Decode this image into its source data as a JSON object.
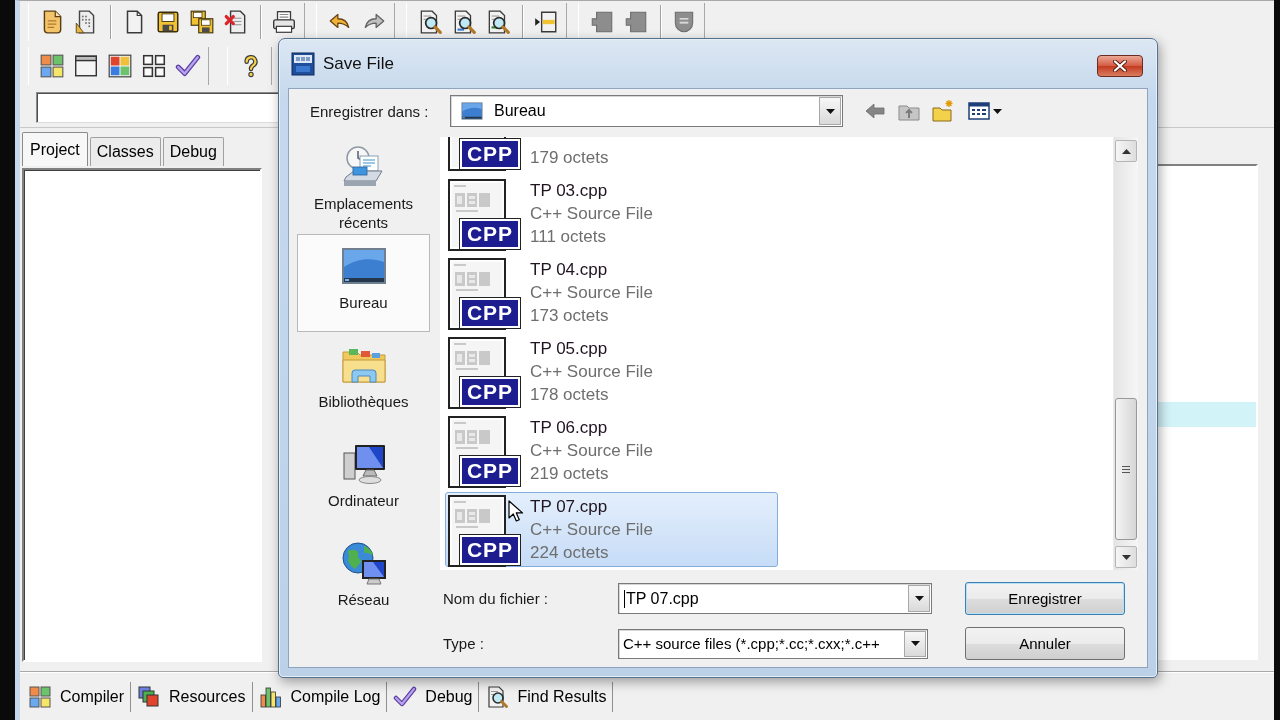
{
  "toolbar_rows": [
    [
      {
        "groups": [
          [
            {
              "kind": "project",
              "disabled": false
            },
            {
              "kind": "template",
              "disabled": false
            }
          ],
          [
            {
              "kind": "file",
              "disabled": false
            },
            {
              "kind": "save",
              "disabled": false
            },
            {
              "kind": "saveall",
              "disabled": false
            },
            {
              "kind": "close",
              "disabled": false
            }
          ],
          [
            {
              "kind": "print",
              "disabled": false
            }
          ]
        ]
      },
      {
        "groups": [
          [
            {
              "kind": "undo",
              "disabled": false
            },
            {
              "kind": "redo",
              "disabled": true
            }
          ]
        ]
      },
      {
        "groups": [
          [
            {
              "kind": "find",
              "disabled": false
            },
            {
              "kind": "replace",
              "disabled": false
            },
            {
              "kind": "findnext",
              "disabled": false
            }
          ],
          [
            {
              "kind": "goto",
              "disabled": false
            }
          ]
        ]
      },
      {
        "groups": [
          [
            {
              "kind": "notch",
              "disabled": true
            },
            {
              "kind": "notch",
              "disabled": true
            }
          ],
          [
            {
              "kind": "shield",
              "disabled": true
            }
          ]
        ]
      }
    ],
    [
      {
        "groups": [
          [
            {
              "kind": "compile",
              "disabled": false
            },
            {
              "kind": "run",
              "disabled": false
            },
            {
              "kind": "compilerun",
              "disabled": false
            },
            {
              "kind": "rebuild",
              "disabled": false
            },
            {
              "kind": "debug",
              "disabled": false
            }
          ]
        ]
      },
      {
        "groups": [
          [
            {
              "kind": "help",
              "disabled": false
            }
          ]
        ]
      }
    ]
  ],
  "left_tabs": [
    {
      "label": "Project",
      "selected": true
    },
    {
      "label": "Classes",
      "selected": false
    },
    {
      "label": "Debug",
      "selected": false
    }
  ],
  "bottom_tabs": [
    {
      "label": "Compiler",
      "kind": "compiler",
      "selected": false
    },
    {
      "label": "Resources",
      "kind": "resources",
      "selected": false
    },
    {
      "label": "Compile Log",
      "kind": "log",
      "selected": false
    },
    {
      "label": "Debug",
      "kind": "debug",
      "selected": false
    },
    {
      "label": "Find Results",
      "kind": "find",
      "selected": false
    }
  ],
  "dialog": {
    "title": "Save File",
    "save_in": {
      "label": "Enregistrer dans :",
      "value": "Bureau"
    },
    "nav_buttons": [
      {
        "kind": "back",
        "disabled": true
      },
      {
        "kind": "up",
        "disabled": true
      },
      {
        "kind": "newfolder",
        "disabled": false
      },
      {
        "kind": "views",
        "disabled": false
      }
    ],
    "places": [
      {
        "kind": "recent",
        "label": "Emplacements récents",
        "selected": false
      },
      {
        "kind": "desktop",
        "label": "Bureau",
        "selected": true
      },
      {
        "kind": "libraries",
        "label": "Bibliothèques",
        "selected": false
      },
      {
        "kind": "computer",
        "label": "Ordinateur",
        "selected": false
      },
      {
        "kind": "network",
        "label": "Réseau",
        "selected": false
      }
    ],
    "files": [
      {
        "kind": "clipped",
        "badge": "CPP",
        "size": "179 octets",
        "selected": false
      },
      {
        "kind": "full",
        "badge": "CPP",
        "name": "TP 03.cpp",
        "type": "C++ Source File",
        "size": "111 octets",
        "selected": false
      },
      {
        "kind": "full",
        "badge": "CPP",
        "name": "TP 04.cpp",
        "type": "C++ Source File",
        "size": "173 octets",
        "selected": false
      },
      {
        "kind": "full",
        "badge": "CPP",
        "name": "TP 05.cpp",
        "type": "C++ Source File",
        "size": "178 octets",
        "selected": false
      },
      {
        "kind": "full",
        "badge": "CPP",
        "name": "TP 06.cpp",
        "type": "C++ Source File",
        "size": "219 octets",
        "selected": false
      },
      {
        "kind": "full",
        "badge": "CPP",
        "name": "TP 07.cpp",
        "type": "C++ Source File",
        "size": "224 octets",
        "selected": true
      }
    ],
    "file_name": {
      "label": "Nom du fichier :",
      "value": "TP 07.cpp",
      "focused": true
    },
    "file_type": {
      "label": "Type :",
      "value": "C++ source files (*.cpp;*.cc;*.cxx;*.c++"
    },
    "buttons": [
      {
        "label": "Enregistrer",
        "default": true
      },
      {
        "label": "Annuler",
        "default": false
      }
    ]
  }
}
